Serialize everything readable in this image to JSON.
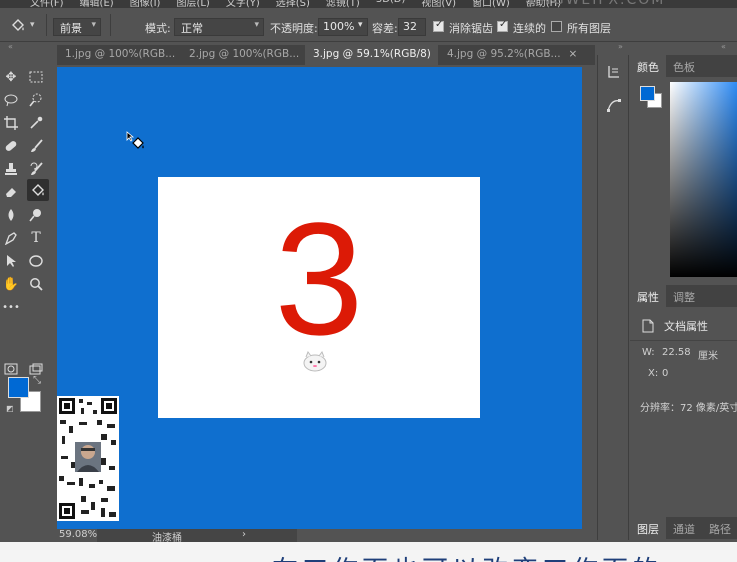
{
  "menu": {
    "items": [
      "文件(F)",
      "编辑(E)",
      "图像(I)",
      "图层(L)",
      "文字(Y)",
      "选择(S)",
      "滤镜(T)",
      "3D(D)",
      "视图(V)",
      "窗口(W)",
      "帮助(H)"
    ],
    "watermark": "JINGWEIFX.COM"
  },
  "options": {
    "tool_icon": "paint-bucket-icon",
    "fill_source": "前景",
    "mode_label": "模式:",
    "mode_value": "正常",
    "opacity_label": "不透明度:",
    "opacity_value": "100%",
    "tolerance_label": "容差:",
    "tolerance_value": "32",
    "antialias_label": "消除锯齿",
    "antialias_checked": true,
    "contiguous_label": "连续的",
    "contiguous_checked": true,
    "all_layers_label": "所有图层",
    "all_layers_checked": false
  },
  "tabs": [
    {
      "label": "1.jpg @ 100%(RGB...",
      "active": false
    },
    {
      "label": "2.jpg @ 100%(RGB...",
      "active": false
    },
    {
      "label": "3.jpg @ 59.1%(RGB/8)",
      "active": true
    },
    {
      "label": "4.jpg @ 95.2%(RGB...",
      "active": false
    }
  ],
  "colors": {
    "foreground": "#0069d4",
    "background": "#ffffff",
    "canvas_fill": "#0f6fcf",
    "digit": "#dc1a06"
  },
  "canvas": {
    "digit": "3"
  },
  "status": {
    "zoom": "59.08%",
    "doc_info": "油漆桶",
    "more_arrow": "›"
  },
  "subtitle": {
    "text": "在工作面也可以改变工作面的"
  },
  "color_panel": {
    "tabs": [
      "颜色",
      "色板"
    ]
  },
  "properties_panel": {
    "tabs": [
      "属性",
      "调整"
    ],
    "title": "文档属性",
    "w_label": "W:",
    "w_value": "22.58",
    "w_unit": "厘米",
    "x_label": "X:",
    "x_value": "0",
    "resolution": "分辨率：72 像素/英寸"
  },
  "layers_panel": {
    "tabs": [
      "图层",
      "通道",
      "路径"
    ]
  }
}
